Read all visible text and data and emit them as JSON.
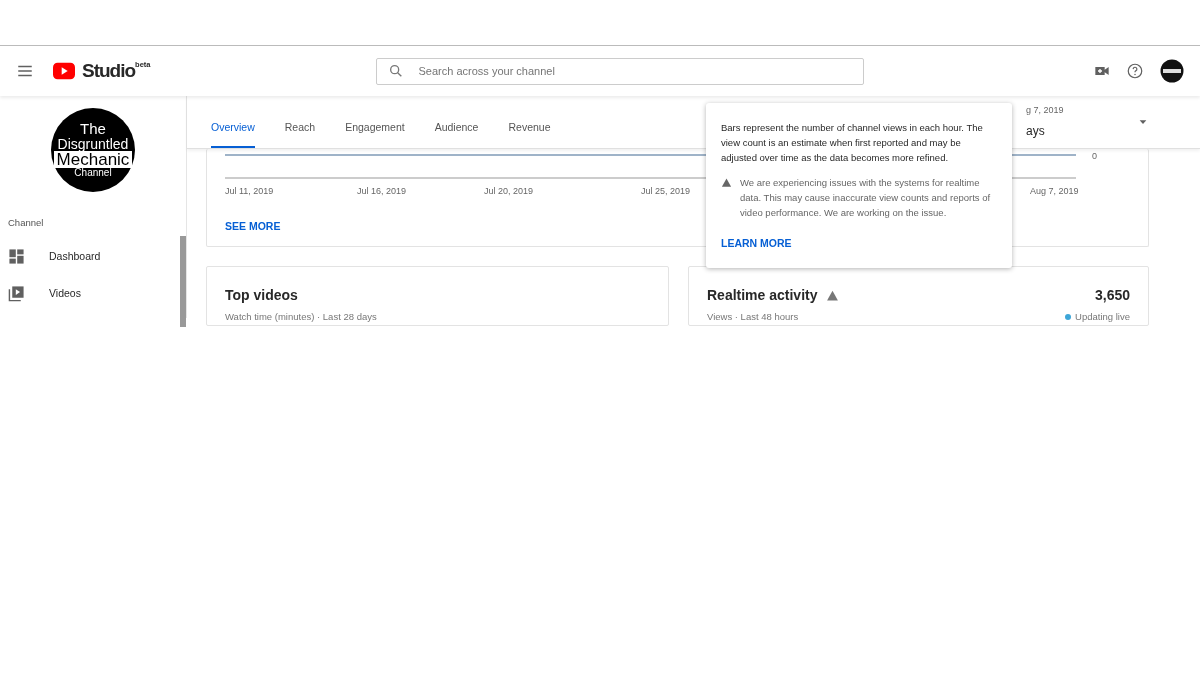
{
  "header": {
    "logo_text": "Studio",
    "logo_badge": "beta",
    "search": {
      "placeholder": "Search across your channel"
    }
  },
  "sidebar": {
    "channel_logo": [
      "The",
      "Disgruntled",
      "Mechanic",
      "Channel"
    ],
    "section_label": "Channel",
    "items": [
      {
        "label": "Dashboard",
        "selected": false
      },
      {
        "label": "Videos",
        "selected": false
      }
    ]
  },
  "tabs": [
    {
      "label": "Overview",
      "selected": true
    },
    {
      "label": "Reach",
      "selected": false
    },
    {
      "label": "Engagement",
      "selected": false
    },
    {
      "label": "Audience",
      "selected": false
    },
    {
      "label": "Revenue",
      "selected": false
    }
  ],
  "date_picker": {
    "range": "g 7, 2019",
    "period": "ays"
  },
  "chart": {
    "y_label": "0",
    "x_labels": [
      "Jul 11, 2019",
      "Jul 16, 2019",
      "Jul 20, 2019",
      "Jul 25, 2019",
      "Aug 7, 2019"
    ],
    "link": "SEE MORE"
  },
  "top_videos": {
    "title": "Top videos",
    "subtitle": "Watch time (minutes) · Last 28 days"
  },
  "realtime": {
    "title": "Realtime activity",
    "subtitle": "Views · Last 48 hours",
    "count": "3,650",
    "status": "Updating live"
  },
  "tooltip": {
    "text": "Bars represent the number of channel views in each hour. The view count is an estimate when first reported and may be adjusted over time as the data becomes more refined.",
    "warning": "We are experiencing issues with the systems for realtime data. This may cause inaccurate view counts and reports of video performance. We are working on the issue.",
    "link": "LEARN MORE"
  }
}
